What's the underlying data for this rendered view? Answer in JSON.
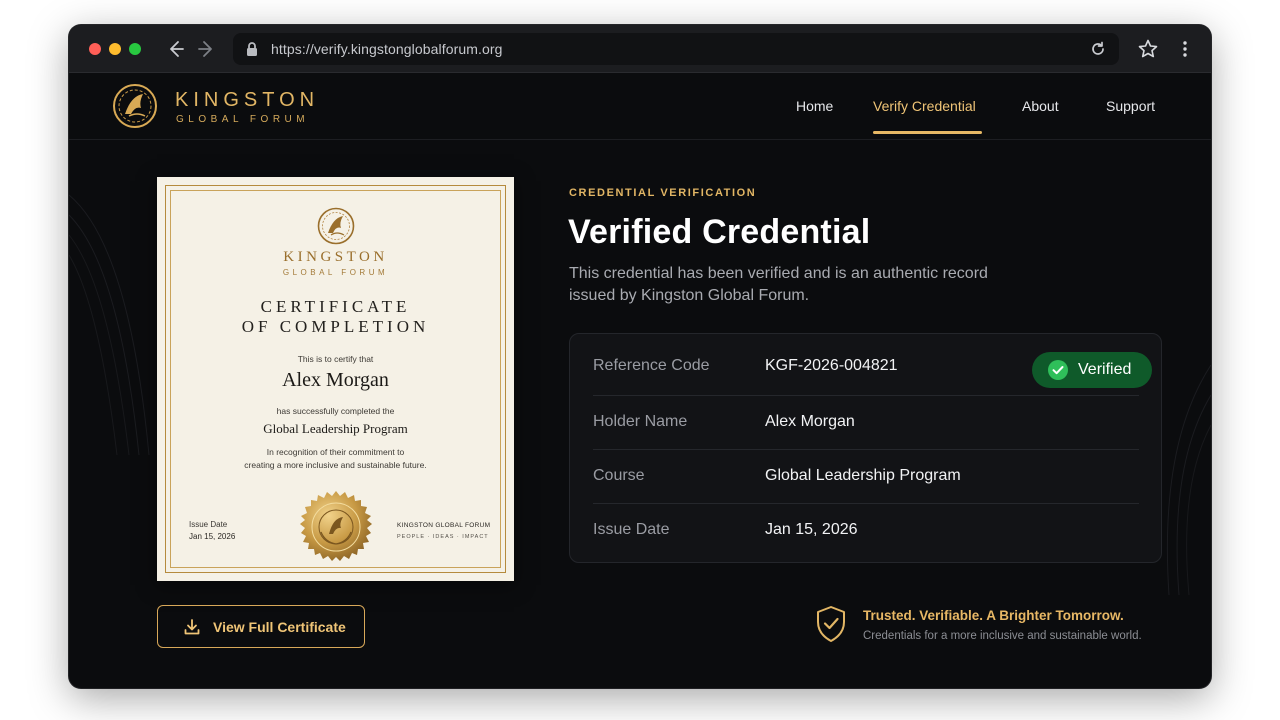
{
  "browser": {
    "url": "https://verify.kingstonglobalforum.org"
  },
  "site": {
    "logo_line1": "KINGSTON",
    "logo_line2": "GLOBAL FORUM",
    "nav": [
      {
        "label": "Home",
        "active": false
      },
      {
        "label": "Verify Credential",
        "active": true
      },
      {
        "label": "About",
        "active": false
      },
      {
        "label": "Support",
        "active": false
      }
    ]
  },
  "certificate": {
    "org_line1": "KINGSTON",
    "org_line2": "GLOBAL FORUM",
    "title_line1": "CERTIFICATE",
    "title_line2": "OF COMPLETION",
    "certify_text": "This is to certify that",
    "holder_name": "Alex Morgan",
    "completed_text": "has successfully completed the",
    "program": "Global Leadership Program",
    "recognition_line1": "In recognition of their commitment to",
    "recognition_line2": "creating a more inclusive and sustainable future.",
    "issue_label": "Issue Date",
    "issue_date": "Jan 15, 2026",
    "footer_org": "KINGSTON GLOBAL FORUM",
    "footer_tagline": "PEOPLE  ·  IDEAS  ·  IMPACT"
  },
  "actions": {
    "view_full_label": "View Full Certificate"
  },
  "verification": {
    "eyebrow": "CREDENTIAL VERIFICATION",
    "headline": "Verified Credential",
    "description_line1": "This credential has been verified and is an authentic record",
    "description_line2": "issued by Kingston Global Forum.",
    "status_badge": "Verified",
    "rows": [
      {
        "label": "Reference Code",
        "value": "KGF-2026-004821"
      },
      {
        "label": "Holder Name",
        "value": "Alex Morgan"
      },
      {
        "label": "Course",
        "value": "Global Leadership Program"
      },
      {
        "label": "Issue Date",
        "value": "Jan 15, 2026"
      }
    ]
  },
  "trust": {
    "title": "Trusted. Verifiable. A Brighter Tomorrow.",
    "subtitle": "Credentials for a more inclusive and sustainable world."
  },
  "colors": {
    "accent_gold": "#e2b665",
    "background": "#0b0c0e",
    "verified_green": "#0f5a2a",
    "check_green": "#2fbf5a"
  }
}
